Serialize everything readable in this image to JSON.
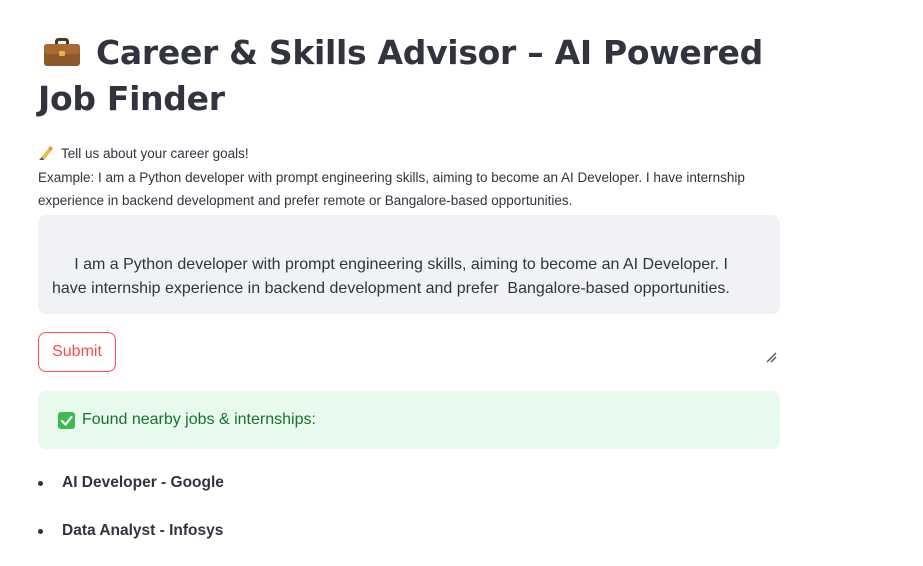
{
  "page": {
    "title": "Career & Skills Advisor – AI Powered Job Finder",
    "title_icon": "briefcase-icon"
  },
  "prompt": {
    "heading": "Tell us about your career goals!",
    "heading_icon": "writing-hand-icon",
    "example": "Example: I am a Python developer with prompt engineering skills, aiming to become an AI Developer. I have internship experience in backend development and prefer remote or Bangalore-based opportunities.",
    "input_value": " I am a Python developer with prompt engineering skills, aiming to become an AI Developer. I have internship experience in backend development and prefer  Bangalore-based opportunities."
  },
  "submit": {
    "label": "Submit"
  },
  "result": {
    "message": "Found nearby jobs & internships:",
    "icon": "check-mark-icon",
    "jobs": [
      "AI Developer - Google",
      "Data Analyst - Infosys"
    ]
  },
  "colors": {
    "accent": "#ff4b4b",
    "success_bg": "#e8f9ee",
    "success_text": "#177233",
    "input_bg": "#f0f2f6"
  }
}
